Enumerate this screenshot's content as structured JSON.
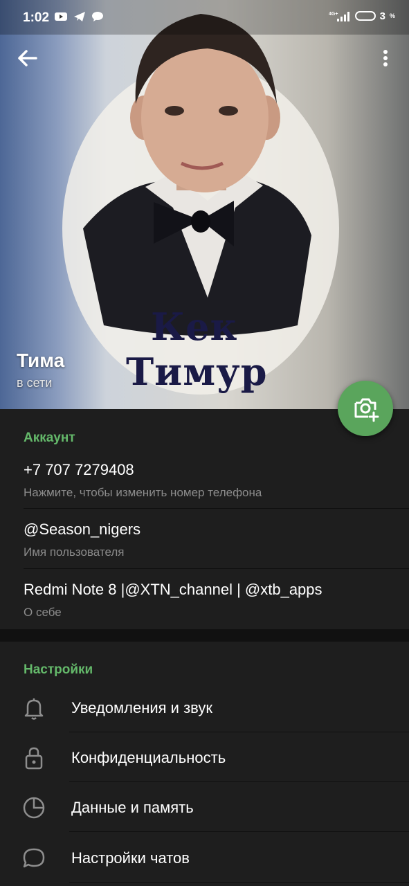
{
  "status_bar": {
    "time": "1:02",
    "network": "4G+",
    "battery_percent": "3"
  },
  "header": {
    "name": "Тима",
    "status": "в сети",
    "photo_caption_line1": "Кек",
    "photo_caption_line2": "Тимур"
  },
  "account": {
    "title": "Аккаунт",
    "items": [
      {
        "value": "+7 707 7279408",
        "hint": "Нажмите, чтобы изменить номер телефона"
      },
      {
        "value": "@Season_nigers",
        "hint": "Имя пользователя"
      },
      {
        "value": "Redmi Note 8 |@XTN_channel | @xtb_apps",
        "hint": "О себе"
      }
    ]
  },
  "settings": {
    "title": "Настройки",
    "items": [
      {
        "label": "Уведомления и звук",
        "icon": "bell-icon"
      },
      {
        "label": "Конфиденциальность",
        "icon": "lock-icon"
      },
      {
        "label": "Данные и память",
        "icon": "pie-chart-icon"
      },
      {
        "label": "Настройки чатов",
        "icon": "chat-bubble-icon"
      }
    ]
  },
  "colors": {
    "accent": "#64b86a",
    "fab": "#5aa55c",
    "background": "#1e1e1e"
  }
}
